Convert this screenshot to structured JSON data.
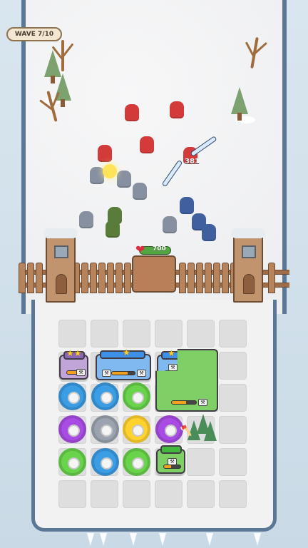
{
  "hud": {
    "wave": "WAVE 7/10",
    "hp": "700",
    "damage": "381"
  },
  "colors": {
    "frame": "#5a7896",
    "health": "#52a63f",
    "heart": "#dc2f3d"
  },
  "icons": [
    "heart-icon",
    "star-icon",
    "gear-icon",
    "sword-icon",
    "tree-icon"
  ]
}
